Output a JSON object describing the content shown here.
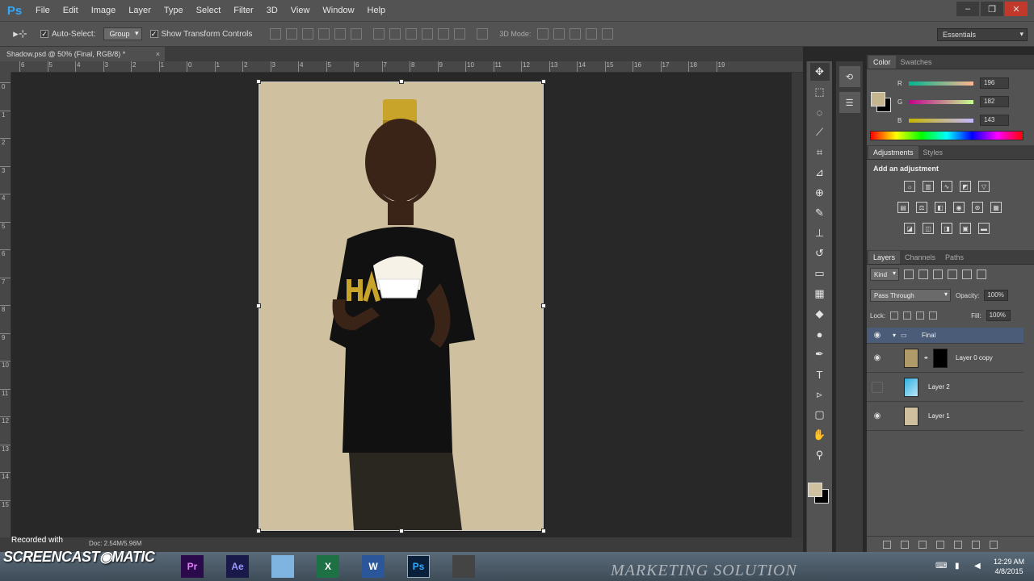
{
  "app": {
    "logo": "Ps"
  },
  "menu": [
    "File",
    "Edit",
    "Image",
    "Layer",
    "Type",
    "Select",
    "Filter",
    "3D",
    "View",
    "Window",
    "Help"
  ],
  "window_controls": [
    "–",
    "❐",
    "✕"
  ],
  "options": {
    "tool_glyph": "▸⊹",
    "auto_select_label": "Auto-Select:",
    "auto_select_checked": "✓",
    "auto_select_target": "Group",
    "show_transform_label": "Show Transform Controls",
    "show_transform_checked": "✓",
    "mode_3d": "3D Mode:",
    "workspace": "Essentials"
  },
  "document": {
    "tab_title": "Shadow.psd @ 50% (Final, RGB/8) *",
    "tab_close": "×",
    "status": "Doc: 2.54M/5.96M",
    "canvas_color": "#cfc0a0"
  },
  "ruler_h": [
    "6",
    "5",
    "4",
    "3",
    "2",
    "1",
    "0",
    "1",
    "2",
    "3",
    "4",
    "5",
    "6",
    "7",
    "8",
    "9",
    "10",
    "11",
    "12",
    "13",
    "14",
    "15",
    "16",
    "17",
    "18",
    "19"
  ],
  "ruler_v": [
    "0",
    "1",
    "2",
    "3",
    "4",
    "5",
    "6",
    "7",
    "8",
    "9",
    "10",
    "11",
    "12",
    "13",
    "14",
    "15"
  ],
  "tools": [
    {
      "name": "move-tool",
      "glyph": "✥"
    },
    {
      "name": "marquee-tool",
      "glyph": "⬚"
    },
    {
      "name": "lasso-tool",
      "glyph": "◌"
    },
    {
      "name": "quick-select-tool",
      "glyph": "⟋"
    },
    {
      "name": "crop-tool",
      "glyph": "⌗"
    },
    {
      "name": "eyedropper-tool",
      "glyph": "⊿"
    },
    {
      "name": "healing-tool",
      "glyph": "⊕"
    },
    {
      "name": "brush-tool",
      "glyph": "✎"
    },
    {
      "name": "clone-stamp-tool",
      "glyph": "⊥"
    },
    {
      "name": "history-brush-tool",
      "glyph": "↺"
    },
    {
      "name": "eraser-tool",
      "glyph": "▭"
    },
    {
      "name": "gradient-tool",
      "glyph": "▦"
    },
    {
      "name": "blur-tool",
      "glyph": "◆"
    },
    {
      "name": "dodge-tool",
      "glyph": "●"
    },
    {
      "name": "pen-tool",
      "glyph": "✒"
    },
    {
      "name": "type-tool",
      "glyph": "T"
    },
    {
      "name": "path-select-tool",
      "glyph": "▹"
    },
    {
      "name": "shape-tool",
      "glyph": "▢"
    },
    {
      "name": "hand-tool",
      "glyph": "✋"
    },
    {
      "name": "zoom-tool",
      "glyph": "⚲"
    }
  ],
  "color_panel": {
    "tabs": [
      "Color",
      "Swatches"
    ],
    "r_label": "R",
    "r_value": "196",
    "g_label": "G",
    "g_value": "182",
    "b_label": "B",
    "b_value": "143",
    "fg_color": "#c4b68f"
  },
  "adjustments_panel": {
    "tabs": [
      "Adjustments",
      "Styles"
    ],
    "title": "Add an adjustment"
  },
  "layers_panel": {
    "tabs": [
      "Layers",
      "Channels",
      "Paths"
    ],
    "kind": "Kind",
    "blend_mode": "Pass Through",
    "opacity_label": "Opacity:",
    "opacity_value": "100%",
    "lock_label": "Lock:",
    "fill_label": "Fill:",
    "fill_value": "100%",
    "layers": [
      {
        "name": "Final",
        "type": "group",
        "visible": true
      },
      {
        "name": "Layer 0 copy",
        "type": "masked",
        "visible": true
      },
      {
        "name": "Layer 2",
        "type": "gradient",
        "visible": false
      },
      {
        "name": "Layer 1",
        "type": "fill",
        "visible": true
      }
    ]
  },
  "watermark": {
    "recorded": "Recorded with",
    "logo": "SCREENCAST◉MATIC",
    "brand": "MARKETING SOLUTION"
  },
  "taskbar": {
    "apps": [
      "Pr",
      "Ae",
      "X",
      "W",
      "Ps"
    ],
    "time": "12:29 AM",
    "date": "4/8/2015"
  }
}
